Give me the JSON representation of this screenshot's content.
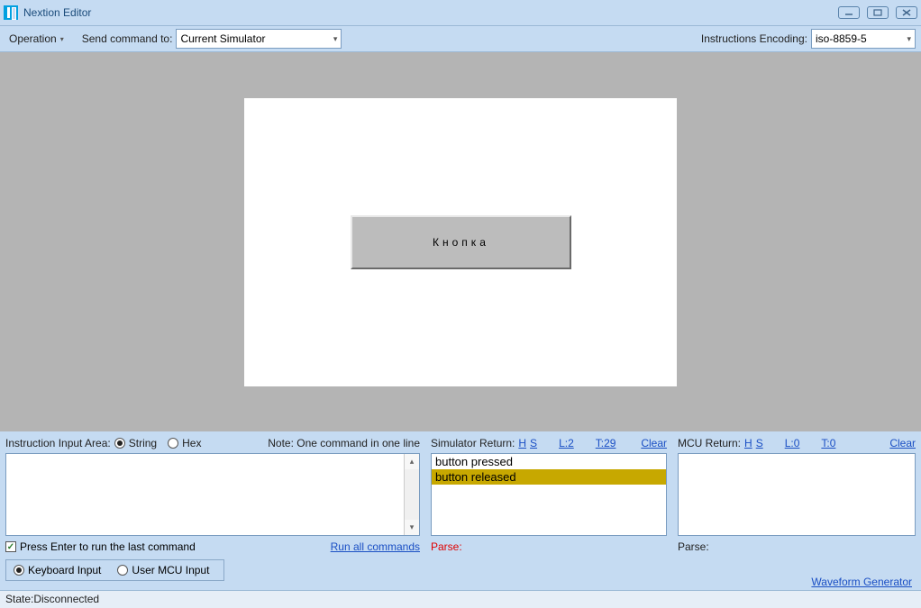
{
  "window": {
    "title": "Nextion Editor"
  },
  "toolbar": {
    "operation_label": "Operation",
    "send_to_label": "Send command to:",
    "send_to_value": "Current Simulator",
    "encoding_label": "Instructions Encoding:",
    "encoding_value": "iso-8859-5"
  },
  "device": {
    "button_text": "Кнопка"
  },
  "input_panel": {
    "label": "Instruction Input Area:",
    "radio_string": "String",
    "radio_hex": "Hex",
    "note": "Note: One command in one line",
    "value": "",
    "check_label": "Press Enter to run the last command",
    "run_all": "Run all commands"
  },
  "sim_return": {
    "label": "Simulator Return:",
    "h": "H",
    "s": "S",
    "l_link": "L:2",
    "t_link": "T:29",
    "clear": "Clear",
    "rows": [
      "button pressed",
      "button released"
    ],
    "parse_label": "Parse:"
  },
  "mcu_return": {
    "label": "MCU Return:",
    "h": "H",
    "s": "S",
    "l_link": "L:0",
    "t_link": "T:0",
    "clear": "Clear",
    "parse_label": "Parse:"
  },
  "source_row": {
    "keyboard": "Keyboard Input",
    "usermcu": "User MCU Input"
  },
  "waveform_link": "Waveform Generator",
  "status": "State:Disconnected"
}
